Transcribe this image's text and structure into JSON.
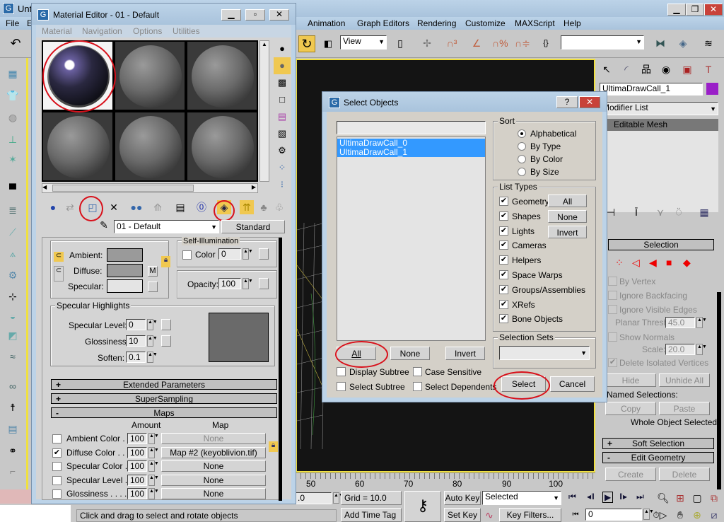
{
  "main_window": {
    "title": "Unt",
    "menu": [
      "File",
      "E",
      "Animation",
      "Graph Editors",
      "Rendering",
      "Customize",
      "MAXScript",
      "Help"
    ],
    "toolbar": {
      "view_dropdown": "View"
    }
  },
  "command_panel": {
    "object_name": "UltimaDrawCall_1",
    "object_color": "#9a1fc8",
    "modifier_list": "Modifier List",
    "stack_item": "Editable Mesh",
    "selection": {
      "title": "Selection",
      "by_vertex": "By Vertex",
      "ignore_backfacing": "Ignore Backfacing",
      "ignore_visible_edges": "Ignore Visible Edges",
      "planar_thresh_label": "Planar Thresh:",
      "planar_thresh": "45.0",
      "show_normals": "Show Normals",
      "scale_label": "Scale:",
      "scale": "20.0",
      "delete_isolated": "Delete Isolated Vertices",
      "hide": "Hide",
      "unhide_all": "Unhide All",
      "named_selections": "Named Selections:",
      "copy": "Copy",
      "paste": "Paste",
      "status": "Whole Object Selected"
    },
    "soft_selection": "Soft Selection",
    "edit_geometry": "Edit Geometry",
    "create": "Create",
    "delete": "Delete"
  },
  "timeline": {
    "ticks": [
      "50",
      "60",
      "70",
      "80",
      "90",
      "100"
    ]
  },
  "statusbar": {
    "coord": ".0",
    "grid": "Grid = 10.0",
    "add_time_tag": "Add Time Tag",
    "auto_key": "Auto Key",
    "set_key": "Set Key",
    "selected": "Selected",
    "key_filters": "Key Filters...",
    "frame": "0",
    "prompt": "Click and drag to select and rotate objects"
  },
  "material_editor": {
    "title": "Material Editor - 01 - Default",
    "menu": [
      "Material",
      "Navigation",
      "Options",
      "Utilities"
    ],
    "material_name": "01 - Default",
    "material_type": "Standard",
    "basic": {
      "ambient": "Ambient:",
      "diffuse": "Diffuse:",
      "specular": "Specular:",
      "m": "M",
      "self_illum": "Self-Illumination",
      "color": "Color",
      "color_value": "0",
      "opacity": "Opacity:",
      "opacity_value": "100"
    },
    "spec_highlights": {
      "title": "Specular Highlights",
      "level_label": "Specular Level:",
      "level": "0",
      "gloss_label": "Glossiness:",
      "gloss": "10",
      "soften_label": "Soften:",
      "soften": "0.1"
    },
    "rollouts": {
      "extended": "Extended Parameters",
      "supersampling": "SuperSampling",
      "maps": "Maps"
    },
    "maps": {
      "amount_header": "Amount",
      "map_header": "Map",
      "rows": [
        {
          "name": "Ambient Color . . .",
          "amount": "100",
          "map": "None",
          "checked": false
        },
        {
          "name": "Diffuse Color . . . .",
          "amount": "100",
          "map": "Map #2 (keyoblivion.tif)",
          "checked": true
        },
        {
          "name": "Specular Color  . .",
          "amount": "100",
          "map": "None",
          "checked": false
        },
        {
          "name": "Specular Level  .",
          "amount": "100",
          "map": "None",
          "checked": false
        },
        {
          "name": "Glossiness . . . . .",
          "amount": "100",
          "map": "None",
          "checked": false
        }
      ]
    }
  },
  "select_objects": {
    "title": "Select Objects",
    "help": "?",
    "search": "",
    "items": [
      "UltimaDrawCall_0",
      "UltimaDrawCall_1"
    ],
    "all": "All",
    "none": "None",
    "invert": "Invert",
    "display_subtree": "Display Subtree",
    "case_sensitive": "Case Sensitive",
    "select_subtree": "Select Subtree",
    "select_dependents": "Select Dependents",
    "sort": {
      "title": "Sort",
      "options": [
        "Alphabetical",
        "By Type",
        "By Color",
        "By Size"
      ],
      "selected": "Alphabetical"
    },
    "list_types": {
      "title": "List Types",
      "items": [
        "Geometry",
        "Shapes",
        "Lights",
        "Cameras",
        "Helpers",
        "Space Warps",
        "Groups/Assemblies",
        "XRefs",
        "Bone Objects"
      ],
      "all": "All",
      "none": "None",
      "invert": "Invert"
    },
    "selection_sets": "Selection Sets",
    "select": "Select",
    "cancel": "Cancel"
  },
  "colors": {
    "annotation": "#d8101a",
    "selection": "#3399ff",
    "viewport_border": "#f0e040"
  }
}
